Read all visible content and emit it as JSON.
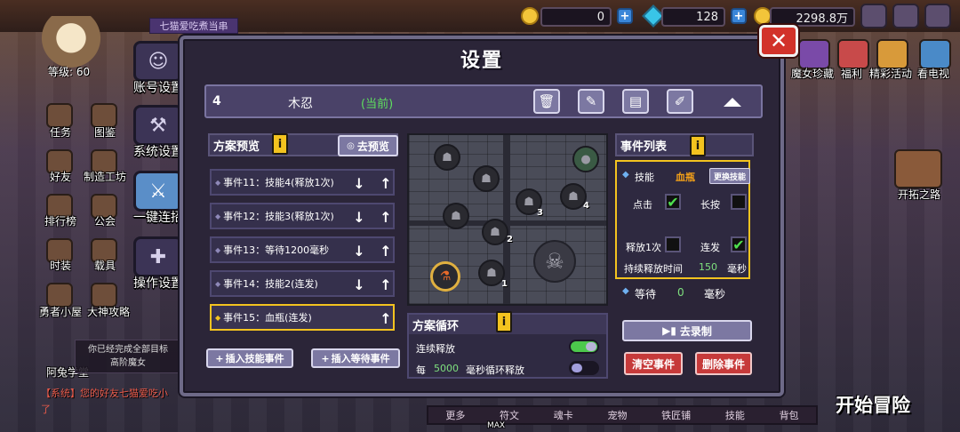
{
  "hud": {
    "currency1": "0",
    "currency2": "128",
    "currency3": "2298.8万",
    "level": "等级: 60",
    "banner": "七猫爱吃煮当串"
  },
  "background": {
    "left_labels": [
      "任务",
      "图鉴",
      "好友",
      "制造工坊",
      "排行榜",
      "公会",
      "时装",
      "载具",
      "勇者小屋",
      "大神攻略",
      "阿兔学堂"
    ],
    "right_labels": [
      "魔女珍藏",
      "福利",
      "精彩活动",
      "看电视",
      "开拓之路"
    ],
    "tip_line1": "你已经完成全部目标",
    "tip_line2": "高阶魔女",
    "system_msg": "【系统】您的好友七猫爱吃小",
    "system_msg2": "了",
    "start": "开始冒险",
    "bottom_menu": [
      "更多",
      "符文",
      "魂卡",
      "宠物",
      "铁匠铺",
      "技能",
      "背包"
    ],
    "max_label": "MAX"
  },
  "side_tabs": [
    {
      "label": "账号设置",
      "icon": "account-icon"
    },
    {
      "label": "系统设置",
      "icon": "wrench-icon"
    },
    {
      "label": "一键连招",
      "icon": "sword-icon",
      "active": true
    },
    {
      "label": "操作设置",
      "icon": "gamepad-icon"
    }
  ],
  "panel": {
    "title": "设置",
    "close": "✕"
  },
  "plan": {
    "number": "4",
    "name": "木忍",
    "current": "(当前)"
  },
  "preview": {
    "header": "方案预览",
    "go_preview": "去预览",
    "events": [
      {
        "text": "事件11：技能4(释放1次)",
        "up": true,
        "down": true
      },
      {
        "text": "事件12：技能3(释放1次)",
        "up": true,
        "down": true
      },
      {
        "text": "事件13：等待1200毫秒",
        "up": true,
        "down": true
      },
      {
        "text": "事件14：技能2(连发)",
        "up": true,
        "down": true
      },
      {
        "text": "事件15：血瓶(连发)",
        "up": true,
        "down": false,
        "selected": true
      }
    ],
    "insert_skill": "插入技能事件",
    "insert_wait": "插入等待事件"
  },
  "map": {
    "node_numbers": [
      "2",
      "3",
      "4",
      "1"
    ]
  },
  "loop": {
    "header": "方案循环",
    "continuous_label": "连续释放",
    "continuous_on": true,
    "every_label": "每",
    "every_value": "5000",
    "every_unit": "毫秒循环释放",
    "every_on": false
  },
  "event_list": {
    "header": "事件列表",
    "skill_label": "技能",
    "skill_value": "血瓶",
    "change_skill": "更换技能",
    "tap_label": "点击",
    "tap_checked": true,
    "hold_label": "长按",
    "hold_checked": false,
    "once_label": "释放1次",
    "once_checked": false,
    "burst_label": "连发",
    "burst_checked": true,
    "duration_label": "持续释放时间",
    "duration_value": "150",
    "duration_unit": "毫秒",
    "wait_label": "等待",
    "wait_value": "0",
    "wait_unit": "毫秒",
    "record": "去录制",
    "clear": "清空事件",
    "delete": "删除事件"
  }
}
